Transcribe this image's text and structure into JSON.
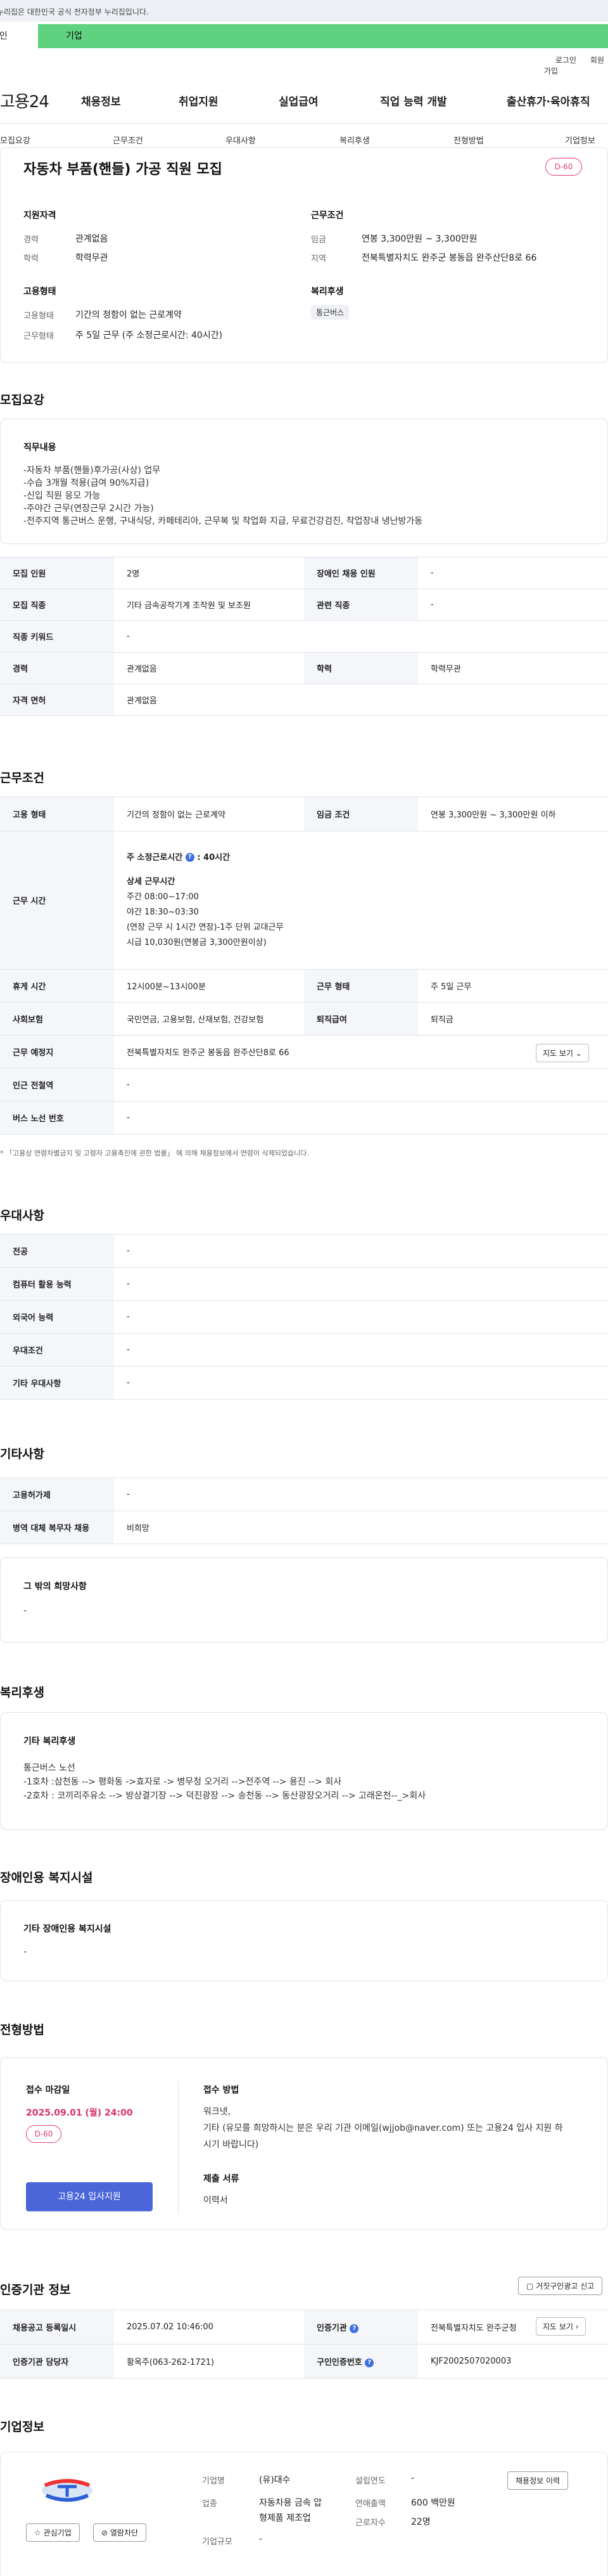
{
  "gov_banner": "이 누리집은 대한민국 공식 전자정부 누리집입니다.",
  "top_tabs": {
    "individual": "개인",
    "corporate": "기업"
  },
  "util": {
    "login": "로그인",
    "signup": "회원가입"
  },
  "logo": "고용24",
  "gnb": [
    "채용정보",
    "취업지원",
    "실업급여",
    "직업 능력 개발",
    "출산휴가·육아휴직"
  ],
  "subnav": [
    "모집요강",
    "근무조건",
    "우대사항",
    "복리후생",
    "전형방법",
    "기업정보"
  ],
  "summary": {
    "title": "자동차 부품(핸들) 가공 직원 모집",
    "dday": "D-60",
    "qual_title": "지원자격",
    "career_label": "경력",
    "career_value": "관계없음",
    "edu_label": "학력",
    "edu_value": "학력무관",
    "cond_title": "근무조건",
    "wage_label": "임금",
    "wage_value": "연봉 3,300만원 ~ 3,300만원",
    "region_label": "지역",
    "region_value": "전북특별자치도 완주군 봉동읍 완주산단8로 66",
    "emp_title": "고용형태",
    "emptype_label": "고용형태",
    "emptype_value": "기간의 정함이 없는 근로계약",
    "worktype_label": "근무형태",
    "worktype_value": "주 5일 근무 (주 소정근로시간: 40시간)",
    "welfare_title": "복리후생",
    "welfare_chip": "통근버스"
  },
  "recruit": {
    "section_title": "모집요강",
    "duty_title": "직무내용",
    "duty_lines": [
      "-자동차 부품(핸들)후가공(사상) 업무",
      "-수습 3개월 적용(급여 90%지급)",
      "-신입 직원 응모 가능",
      "-주야간 근무(연장근무 2시간 가능)",
      "-전주지역 통근버스 운행, 구내식당, 카페테리아, 근무복 및 작업화 지급, 무료건강검진, 작업장내 냉난방가동"
    ],
    "rows": [
      {
        "k1": "모집 인원",
        "v1": "2명",
        "k2": "장애인 채용 인원",
        "v2": "-"
      },
      {
        "k1": "모집 직종",
        "v1": "기타 금속공작기계 조작원 및 보조원",
        "k2": "관련 직종",
        "v2": "-"
      },
      {
        "k1": "직종 키워드",
        "v1": "-"
      },
      {
        "k1": "경력",
        "v1": "관계없음",
        "k2": "학력",
        "v2": "학력무관"
      },
      {
        "k1": "자격 면허",
        "v1": "관계없음"
      }
    ]
  },
  "work": {
    "section_title": "근무조건",
    "emptype_label": "고용 형태",
    "emptype_value": "기간의 정함이 없는 근로계약",
    "wage_label": "임금 조건",
    "wage_value": "연봉 3,300만원 ~ 3,300만원 이하",
    "time_label": "근무 시간",
    "time_hours": "주 소정근로시간",
    "time_hours_value": ": 40시간",
    "time_detail_title": "상세 근무시간",
    "time_lines": [
      "주간 08:00~17:00",
      "야간 18:30~03:30",
      "(연장 근무 시 1시간 연장)-1주 단위 교대근무",
      "시급 10,030원(연봉금 3,300만원이상)"
    ],
    "break_label": "휴게 시간",
    "break_value": "12시00분~13시00분",
    "shift_label": "근무 형태",
    "shift_value": "주 5일 근무",
    "insurance_label": "사회보험",
    "insurance_value": "국민연금, 고용보험, 산재보험, 건강보험",
    "retire_label": "퇴직급여",
    "retire_value": "퇴직금",
    "place_label": "근무 예정지",
    "place_value": "전북특별자치도 완주군 봉동읍 완주산단8로 66",
    "map_btn": "지도 보기 ⌄",
    "subway_label": "인근 전철역",
    "subway_value": "-",
    "bus_label": "버스 노선 번호",
    "bus_value": "-",
    "note": "* 「고용상 연령차별금지 및 고령자 고용촉진에 관한 법률」 에 의해 채용정보에서 연령이 삭제되었습니다."
  },
  "pref": {
    "section_title": "우대사항",
    "rows": [
      {
        "k": "전공",
        "v": "-"
      },
      {
        "k": "컴퓨터 활용 능력",
        "v": "-"
      },
      {
        "k": "외국어 능력",
        "v": "-"
      },
      {
        "k": "우대조건",
        "v": "-"
      },
      {
        "k": "기타 우대사항",
        "v": "-"
      }
    ]
  },
  "etc": {
    "section_title": "기타사항",
    "rows": [
      {
        "k": "고용허가제",
        "v": "-"
      },
      {
        "k": "병역 대체 복무자 채용",
        "v": "비희망"
      }
    ],
    "hope_title": "그 밖의 희망사항",
    "hope_value": "-"
  },
  "welfare": {
    "section_title": "복리후생",
    "box_title": "기타 복리후생",
    "lines": [
      "통근버스 노선",
      "-1호차 :삼천동 --> 평화동 ->효자로 -> 병무청 오거리 -->전주역 --> 용진 --> 회사",
      "-2호차 : 코끼리주유소 --> 방상결기장 --> 덕진광장 --> 송천동 --> 동산광장오거리 --> 고래온천--_>회사"
    ]
  },
  "disability": {
    "section_title": "장애인용 복지시설",
    "box_title": "기타 장애인용 복지시설",
    "value": "-"
  },
  "process": {
    "section_title": "전형방법",
    "deadline_title": "접수 마감일",
    "deadline_value": "2025.09.01 (월) 24:00",
    "dday": "D-60",
    "apply_btn": "고용24 입사지원",
    "method_title": "접수 방법",
    "method_lines": [
      "워크넷,",
      "기타 (유모를 희망하시는 분은 우리 기관 이메일(wjjob@naver.com) 또는 고용24 입사 지원 하",
      "시기 바랍니다)"
    ],
    "docs_title": "제출 서류",
    "docs_value": "이력서"
  },
  "agency": {
    "section_title": "인증기관 정보",
    "report_btn": "거짓구인광고 신고",
    "reg_label": "채용공고 등록일시",
    "reg_value": "2025.07.02 10:46:00",
    "agency_label": "인증기관",
    "agency_value": "전북특별자치도 완주군청",
    "map_btn": "지도 보기 ›",
    "manager_label": "인증기관 담당자",
    "manager_value": "황옥주(063-262-1721)",
    "id_label": "구인인증번호",
    "id_value": "KJF2002507020003"
  },
  "company": {
    "section_title": "기업정보",
    "name_label": "기업명",
    "name_value": "(유)대수",
    "industry_label": "업종",
    "industry_value_1": "자동차용 금속 압",
    "industry_value_2": "형제품 제조업",
    "size_label": "기업규모",
    "size_value": "-",
    "founded_label": "설립연도",
    "founded_value": "-",
    "sales_label": "연매출액",
    "sales_value": "600 백만원",
    "staff_label": "근로자수",
    "staff_value": "22명",
    "jobs_btn": "채용정보 이력",
    "fav_btn": "☆ 관심기업",
    "block_btn": "⊘ 열람차단"
  },
  "colors": {
    "accent_green": "#5fd180",
    "primary_blue": "#4a66d9",
    "dday_red": "#e0407a"
  }
}
